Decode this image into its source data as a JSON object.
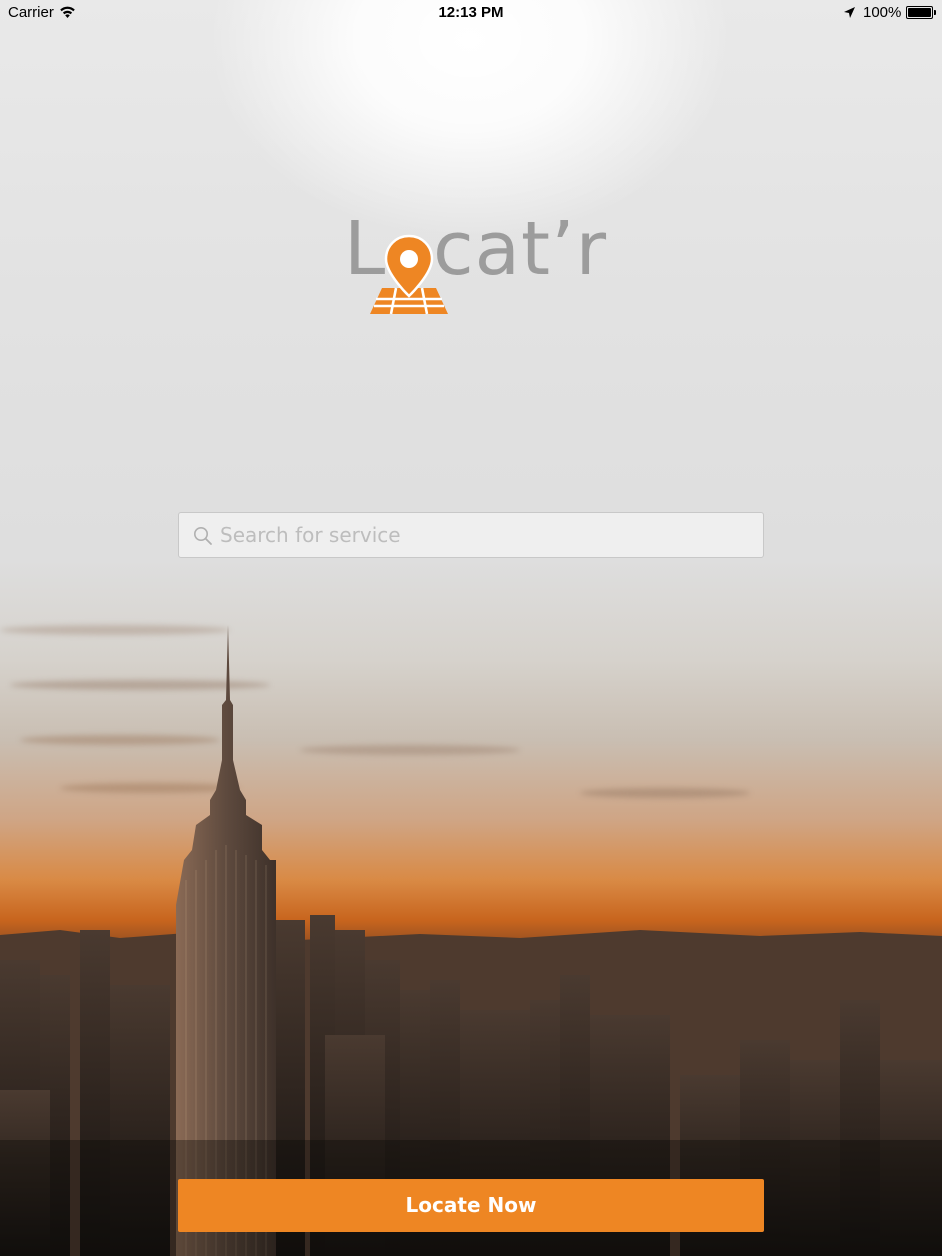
{
  "status_bar": {
    "carrier": "Carrier",
    "time": "12:13 PM",
    "battery": "100%"
  },
  "logo": {
    "first_letter": "L",
    "rest": "cat’r"
  },
  "search": {
    "placeholder": "Search for service"
  },
  "locate_button": {
    "label": "Locate Now"
  },
  "colors": {
    "accent": "#ee8623",
    "logo_text": "#9c9c9c"
  },
  "icons": {
    "search": "search-icon",
    "wifi": "wifi-icon",
    "location": "location-arrow-icon",
    "battery": "battery-icon",
    "logo_mark": "map-pin-icon"
  }
}
